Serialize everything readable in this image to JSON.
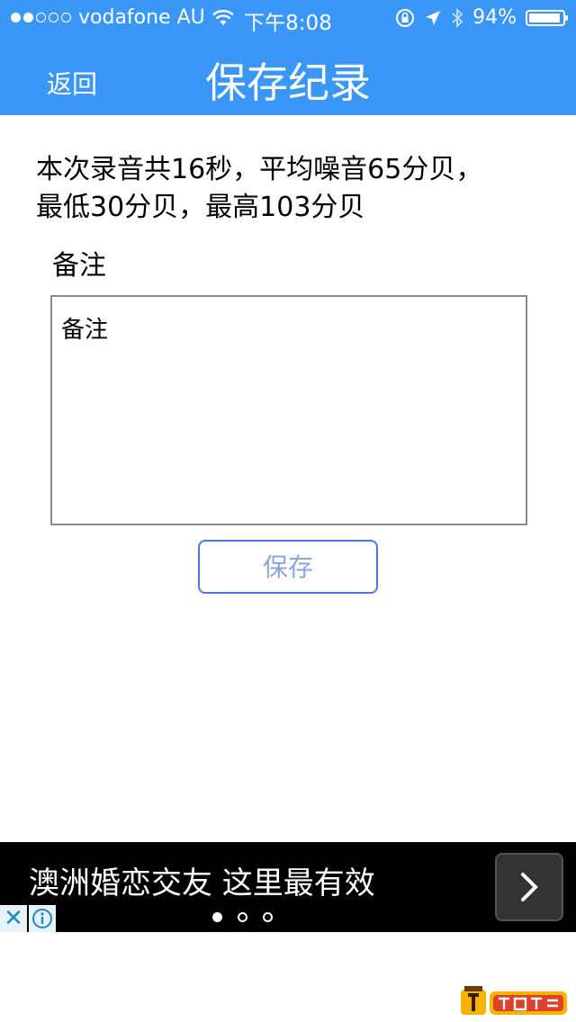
{
  "status_bar": {
    "carrier": "vodafone AU",
    "time": "下午8:08",
    "battery": "94%",
    "battery_level": 0.94
  },
  "nav": {
    "back_label": "返回",
    "title": "保存纪录"
  },
  "summary": {
    "text": "本次录音共16秒，平均噪音65分贝，最低30分贝，最高103分贝"
  },
  "note": {
    "label": "备注",
    "placeholder": "备注"
  },
  "save_button": {
    "label": "保存"
  },
  "ad": {
    "text": "澳洲婚恋交友 这里最有效",
    "close_glyph": "✕",
    "page_count": 3,
    "current_page": 1
  },
  "colors": {
    "header_bg": "#3b97f7",
    "button_border": "#4a79d6",
    "button_text": "#8aa6e0"
  }
}
